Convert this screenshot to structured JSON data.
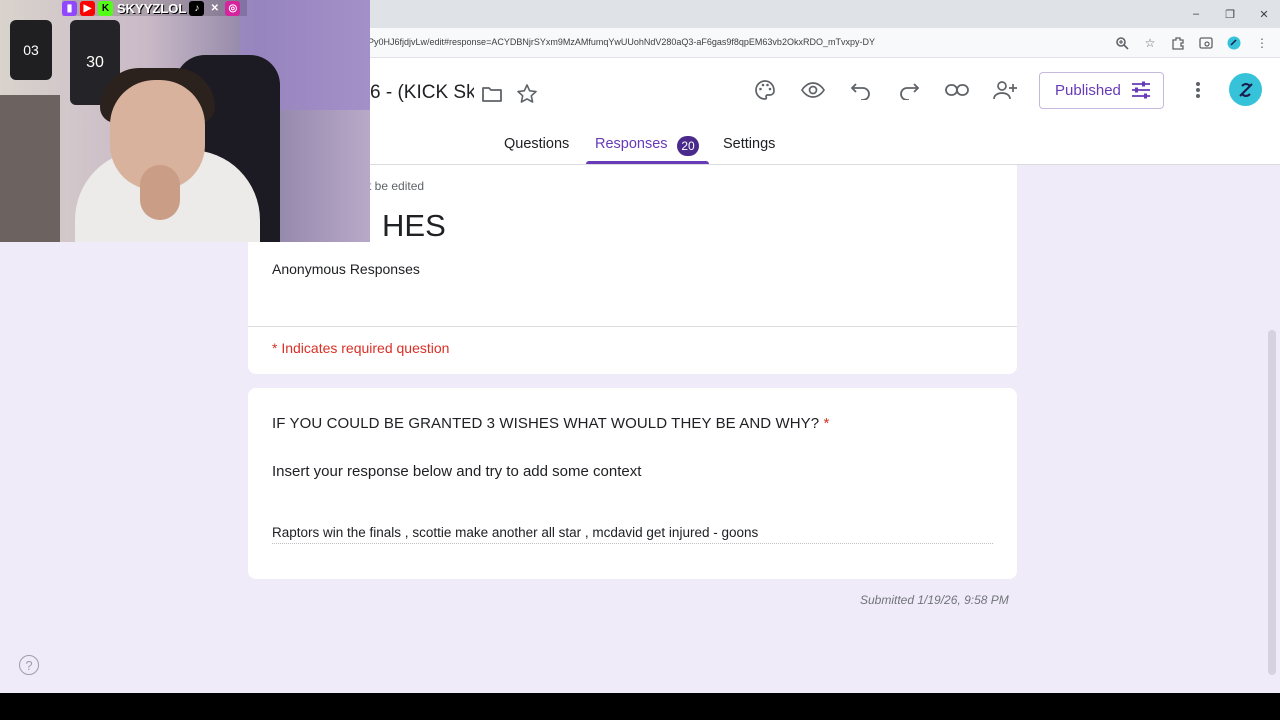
{
  "browser": {
    "url": "Py0HJ6fjdjvLw/edit#response=ACYDBNjrSYxm9MzAMfumqYwUUohNdV280aQ3-aF6gas9f8qpEM63vb2OkxRDO_mTvxpy-DY",
    "window_controls": [
      "–",
      "❐",
      "✕"
    ],
    "icons": [
      "zoom-icon",
      "star-icon",
      "extensions-icon",
      "tab-search-icon",
      "profile-icon",
      "menu-icon"
    ]
  },
  "header": {
    "doc_title": "6 -  (KICK Sky",
    "published_label": "Published",
    "accent_color": "#673ab7"
  },
  "tabs": [
    {
      "label": "Questions"
    },
    {
      "label": "Responses",
      "badge": "20"
    },
    {
      "label": "Settings"
    }
  ],
  "form": {
    "edit_note": "t be edited",
    "title": "HES",
    "description": "Anonymous Responses",
    "required_note": "* Indicates required question"
  },
  "question": {
    "text": "IF YOU COULD BE GRANTED 3 WISHES WHAT WOULD THEY BE AND WHY?",
    "required_mark": "*",
    "description": "Insert your response below and try to add some context",
    "answer": "Raptors win the finals , scottie make another all star , mcdavid get injured - goons"
  },
  "submitted": "Submitted 1/19/26, 9:58 PM",
  "overlay": {
    "streamer_name": "SKYYZLOL",
    "jersey_left": "03",
    "jersey_right": "30"
  }
}
